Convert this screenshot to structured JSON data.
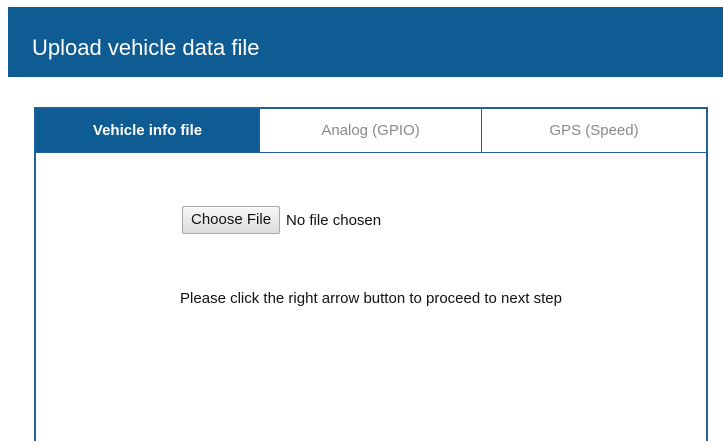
{
  "header": {
    "title": "Upload vehicle data file"
  },
  "tabs": [
    {
      "label": "Vehicle info file",
      "active": true
    },
    {
      "label": "Analog (GPIO)",
      "active": false
    },
    {
      "label": "GPS (Speed)",
      "active": false
    }
  ],
  "file_input": {
    "button_label": "Choose File",
    "status": "No file chosen"
  },
  "instruction": "Please click the right arrow button to proceed to next step",
  "colors": {
    "header_bg": "#0f5b94",
    "active_tab_bg": "#0f5b94",
    "border": "#1f5f9a",
    "inactive_tab_text": "#8a8a8a"
  }
}
